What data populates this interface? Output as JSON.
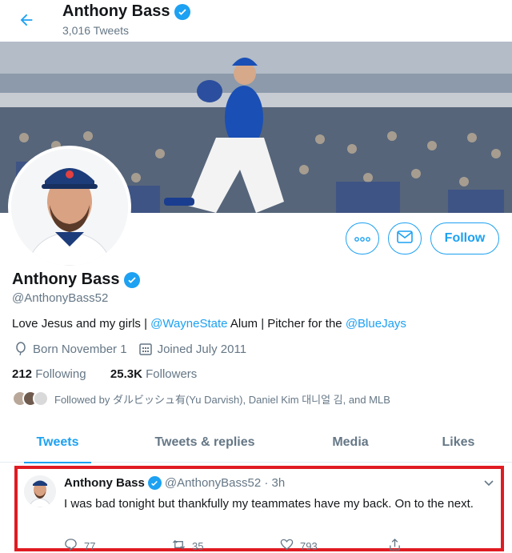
{
  "header": {
    "back_icon": "arrow-left-icon",
    "name": "Anthony Bass",
    "tweet_count": "3,016 Tweets"
  },
  "profile": {
    "name": "Anthony Bass",
    "handle": "@AnthonyBass52",
    "bio": {
      "part1": "Love Jesus and my girls | ",
      "link1": "@WayneState",
      "part2": " Alum | Pitcher for the ",
      "link2": "@BlueJays"
    },
    "born": "Born November 1",
    "joined": "Joined July 2011",
    "following_count": "212",
    "following_label": "Following",
    "followers_count": "25.3K",
    "followers_label": "Followers",
    "followed_by": "Followed by ダルビッシュ有(Yu Darvish), Daniel Kim 대니얼 김, and MLB"
  },
  "actions": {
    "more_icon": "more-icon",
    "message_icon": "envelope-icon",
    "follow_label": "Follow"
  },
  "tabs": [
    {
      "label": "Tweets",
      "active": true
    },
    {
      "label": "Tweets & replies",
      "active": false
    },
    {
      "label": "Media",
      "active": false
    },
    {
      "label": "Likes",
      "active": false
    }
  ],
  "tweet": {
    "name": "Anthony Bass",
    "handle_time": "@AnthonyBass52 · 3h",
    "text": "I was bad tonight but thankfully my teammates have my back. On to the next.",
    "replies": "77",
    "retweets": "35",
    "likes": "793"
  },
  "colors": {
    "accent": "#1da1f2",
    "highlight_border": "#e01b22"
  }
}
